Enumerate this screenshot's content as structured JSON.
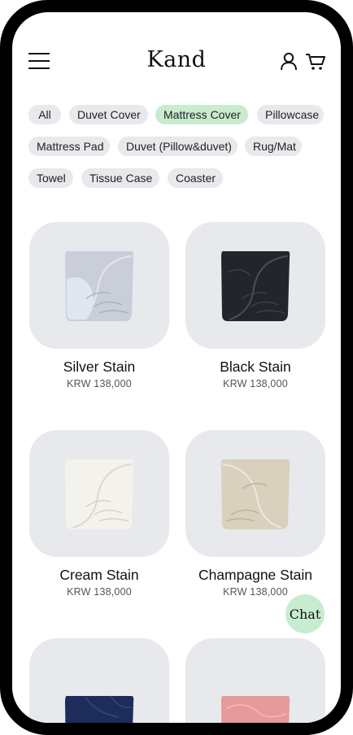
{
  "header": {
    "brand": "Kand",
    "menu_icon": "hamburger-icon",
    "account_icon": "user-icon",
    "cart_icon": "cart-icon"
  },
  "categories": [
    {
      "label": "All",
      "active": false
    },
    {
      "label": "Duvet Cover",
      "active": false
    },
    {
      "label": "Mattress Cover",
      "active": true
    },
    {
      "label": "Pillowcase",
      "active": false
    },
    {
      "label": "Mattress Pad",
      "active": false
    },
    {
      "label": "Duvet (Pillow&duvet)",
      "active": false
    },
    {
      "label": "Rug/Mat",
      "active": false
    },
    {
      "label": "Towel",
      "active": false
    },
    {
      "label": "Tissue Case",
      "active": false
    },
    {
      "label": "Coaster",
      "active": false
    }
  ],
  "products": [
    {
      "name": "Silver Stain",
      "price": "KRW 138,000",
      "fabric_color": "#c9ced8",
      "image_icon": "folded-sheet-icon"
    },
    {
      "name": "Black Stain",
      "price": "KRW 138,000",
      "fabric_color": "#23252c",
      "image_icon": "folded-sheet-icon"
    },
    {
      "name": "Cream Stain",
      "price": "KRW 138,000",
      "fabric_color": "#f4f2ec",
      "image_icon": "folded-sheet-icon"
    },
    {
      "name": "Champagne Stain",
      "price": "KRW 138,000",
      "fabric_color": "#d9d0bd",
      "image_icon": "folded-sheet-icon"
    },
    {
      "name": "",
      "price": "",
      "fabric_color": "#1e2c5c",
      "image_icon": "folded-sheet-icon"
    },
    {
      "name": "",
      "price": "",
      "fabric_color": "#e69a9a",
      "image_icon": "folded-sheet-icon"
    }
  ],
  "chat": {
    "label": "Chat"
  },
  "colors": {
    "accent_chip": "#c8ecd0",
    "chip_bg": "#e8e9ec",
    "card_bg": "#e8e9ec"
  }
}
